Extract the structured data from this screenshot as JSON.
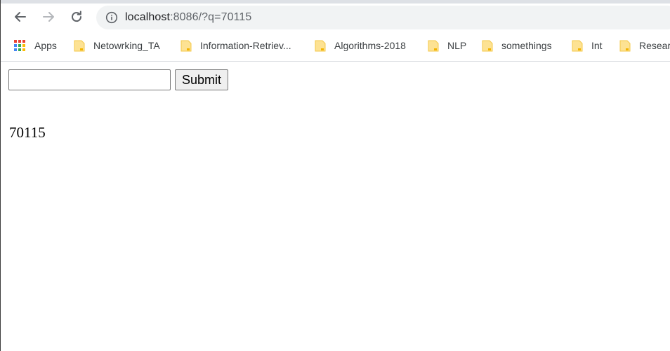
{
  "browser": {
    "url_host": "localhost",
    "url_rest": ":8086/?q=70115",
    "icons": {
      "back": "back-arrow-icon",
      "forward": "forward-arrow-icon",
      "reload": "reload-icon",
      "info": "info-icon"
    }
  },
  "bookmarks": [
    {
      "label": "Apps",
      "icon": "apps-grid-icon"
    },
    {
      "label": "Netowrking_TA",
      "icon": "folder-icon"
    },
    {
      "label": "Information-Retriev...",
      "icon": "folder-icon"
    },
    {
      "label": "Algorithms-2018",
      "icon": "folder-icon"
    },
    {
      "label": "NLP",
      "icon": "folder-icon"
    },
    {
      "label": "somethings",
      "icon": "folder-icon"
    },
    {
      "label": "Int",
      "icon": "folder-icon"
    },
    {
      "label": "Resear",
      "icon": "folder-icon"
    }
  ],
  "form": {
    "input_value": "",
    "submit_label": "Submit"
  },
  "result": {
    "text": "70115"
  },
  "colors": {
    "omnibox_bg": "#f1f3f4",
    "folder": "#fdd663",
    "folder_dark": "#f7c34a"
  }
}
